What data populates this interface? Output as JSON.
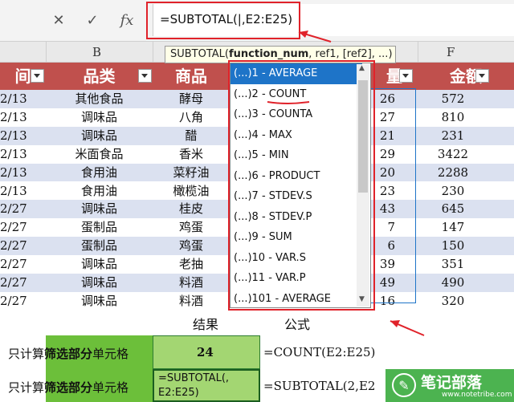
{
  "formula_bar": {
    "cancel_icon": "✕",
    "enter_icon": "✓",
    "fx_label": "fx",
    "formula": "=SUBTOTAL(|,E2:E25)"
  },
  "columns": {
    "b": "B",
    "f": "F"
  },
  "headers": {
    "date": "间",
    "category": "品类",
    "product": "商品",
    "qty": "量",
    "amount": "金额"
  },
  "rows": [
    {
      "date": "2/13",
      "category": "其他食品",
      "product": "酵母",
      "qty": "26",
      "amount": "572"
    },
    {
      "date": "2/13",
      "category": "调味品",
      "product": "八角",
      "qty": "27",
      "amount": "810"
    },
    {
      "date": "2/13",
      "category": "调味品",
      "product": "醋",
      "qty": "21",
      "amount": "231"
    },
    {
      "date": "2/13",
      "category": "米面食品",
      "product": "香米",
      "qty": "29",
      "amount": "3422"
    },
    {
      "date": "2/13",
      "category": "食用油",
      "product": "菜籽油",
      "qty": "20",
      "amount": "2288"
    },
    {
      "date": "2/13",
      "category": "食用油",
      "product": "橄榄油",
      "qty": "23",
      "amount": "230"
    },
    {
      "date": "2/27",
      "category": "调味品",
      "product": "桂皮",
      "qty": "43",
      "amount": "645"
    },
    {
      "date": "2/27",
      "category": "蛋制品",
      "product": "鸡蛋",
      "qty": "7",
      "amount": "147"
    },
    {
      "date": "2/27",
      "category": "蛋制品",
      "product": "鸡蛋",
      "qty": "6",
      "amount": "150"
    },
    {
      "date": "2/27",
      "category": "调味品",
      "product": "老抽",
      "qty": "39",
      "amount": "351"
    },
    {
      "date": "2/27",
      "category": "调味品",
      "product": "料酒",
      "qty": "49",
      "amount": "490"
    },
    {
      "date": "2/27",
      "category": "调味品",
      "product": "料酒",
      "qty": "16",
      "amount": "320"
    }
  ],
  "bottom": {
    "result_label": "结果",
    "formula_label": "公式",
    "row1": {
      "prefix": "只计算",
      "bold": "筛选部分",
      "suffix": "单元格",
      "result": "24",
      "formula": "=COUNT(E2:E25)"
    },
    "row2": {
      "prefix": "只计算",
      "bold": "筛选部分",
      "suffix": "单元格",
      "result_line1": "=SUBTOTAL(,",
      "result_line2": "E2:E25)",
      "formula": "=SUBTOTAL(2,E2"
    }
  },
  "tooltip": {
    "fn": "SUBTOTAL(",
    "arg_bold": "function_num",
    "rest": ", ref1, [ref2], ...)"
  },
  "dropdown": {
    "items": [
      "(...)1 - AVERAGE",
      "(...)2 - COUNT",
      "(...)3 - COUNTA",
      "(...)4 - MAX",
      "(...)5 - MIN",
      "(...)6 - PRODUCT",
      "(...)7 - STDEV.S",
      "(...)8 - STDEV.P",
      "(...)9 - SUM",
      "(...)10 - VAR.S",
      "(...)11 - VAR.P",
      "(...)101 - AVERAGE"
    ],
    "selected_index": 0
  },
  "watermark": {
    "name": "笔记部落",
    "url": "www.notetribe.com"
  },
  "colors": {
    "header": "#c0504d",
    "band": "#dbe1f0",
    "highlight_red": "#e0222a",
    "select_blue": "#1e74c8",
    "green": "#6cbf3a"
  }
}
